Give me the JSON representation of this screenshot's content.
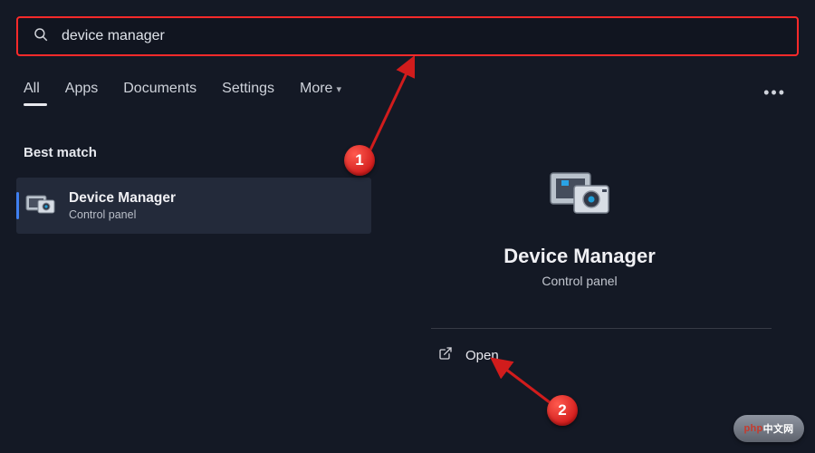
{
  "search": {
    "value": "device manager"
  },
  "tabs": {
    "all": "All",
    "apps": "Apps",
    "documents": "Documents",
    "settings": "Settings",
    "more": "More"
  },
  "section": {
    "best_match": "Best match"
  },
  "result": {
    "title": "Device Manager",
    "subtitle": "Control panel"
  },
  "detail": {
    "title": "Device Manager",
    "subtitle": "Control panel"
  },
  "actions": {
    "open": "Open"
  },
  "annotations": {
    "step1": "1",
    "step2": "2"
  },
  "watermark": {
    "left": "php",
    "right": "中文网"
  }
}
